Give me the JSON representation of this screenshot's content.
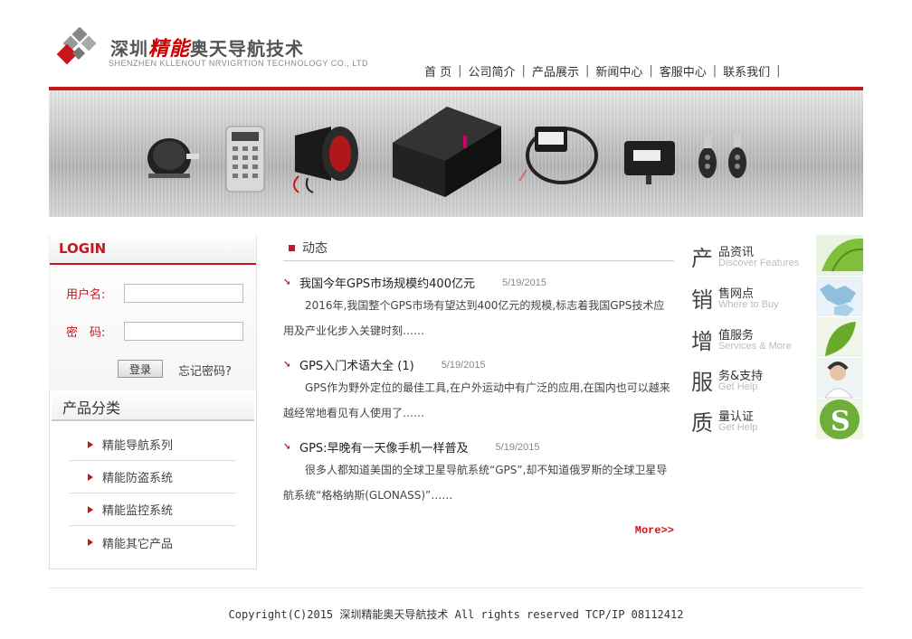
{
  "header": {
    "logo_cn_a": "深圳",
    "logo_cn_b": "精能",
    "logo_cn_c": "奥天导航技术",
    "logo_en": "SHENZHEN KLLENOUT NRVIGRTION TECHNOLOGY CO., LTD",
    "accent_color": "#c8161d"
  },
  "nav": {
    "items": [
      "首 页",
      "公司简介",
      "产品展示",
      "新闻中心",
      "客服中心",
      "联系我们"
    ]
  },
  "login": {
    "title": "LOGIN",
    "username_label": "用户名:",
    "password_label": "密　码:",
    "username_value": "",
    "password_value": "",
    "submit_label": "登录",
    "forgot_label": "忘记密码?"
  },
  "categories": {
    "title": "产品分类",
    "items": [
      "精能导航系列",
      "精能防盗系统",
      "精能监控系统",
      "精能其它产品"
    ]
  },
  "news": {
    "title": "动态",
    "items": [
      {
        "title": "我国今年GPS市场规模约400亿元",
        "date": "5/19/2015",
        "body": "2016年,我国整个GPS市场有望达到400亿元的规模,标志着我国GPS技术应用及产业化步入关键时刻……"
      },
      {
        "title": "GPS入门术语大全 (1)",
        "date": "5/19/2015",
        "body": "GPS作为野外定位的最佳工具,在户外运动中有广泛的应用,在国内也可以越来越经常地看见有人使用了……"
      },
      {
        "title": "GPS:早晚有一天像手机一样普及",
        "date": "5/19/2015",
        "body": "很多人都知道美国的全球卫星导航系统“GPS”,却不知道俄罗斯的全球卫星导航系统“格格纳斯(GLONASS)”……"
      }
    ],
    "more_label": "More>>"
  },
  "services": [
    {
      "big": "产",
      "cn": "品资讯",
      "en": "Discover Features"
    },
    {
      "big": "销",
      "cn": "售网点",
      "en": "Where to Buy"
    },
    {
      "big": "增",
      "cn": "值服务",
      "en": "Services & More"
    },
    {
      "big": "服",
      "cn": "务&支持",
      "en": "Get Help"
    },
    {
      "big": "质",
      "cn": "量认证",
      "en": "Get Help"
    }
  ],
  "footer": {
    "copyright": "Copyright(C)2015 深圳精能奥天导航技术 All rights reserved TCP/IP 08112412"
  }
}
